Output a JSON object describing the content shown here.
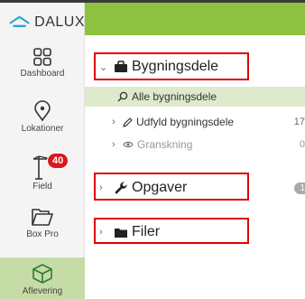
{
  "app": {
    "logo_text": "DALUX"
  },
  "nav": {
    "items": [
      {
        "label": "Dashboard",
        "icon": "dashboard-icon"
      },
      {
        "label": "Lokationer",
        "icon": "location-pin-icon"
      },
      {
        "label": "Field",
        "icon": "crane-icon",
        "badge": "40"
      },
      {
        "label": "Box Pro",
        "icon": "folder-open-icon"
      },
      {
        "label": "Aflevering",
        "icon": "package-icon",
        "active": true
      }
    ]
  },
  "tree": {
    "bygningsdele": {
      "label": "Bygningsdele",
      "children": [
        {
          "label": "Alle bygningsdele",
          "selected": true
        },
        {
          "label": "Udfyld bygningsdele",
          "count": "17"
        },
        {
          "label": "Granskning",
          "count": "0"
        }
      ]
    },
    "opgaver": {
      "label": "Opgaver",
      "count": "1"
    },
    "filer": {
      "label": "Filer"
    }
  },
  "colors": {
    "accent": "#8dc241",
    "selected_bg": "#ddeacb",
    "highlight": "#e00000",
    "badge": "#d8191f"
  }
}
